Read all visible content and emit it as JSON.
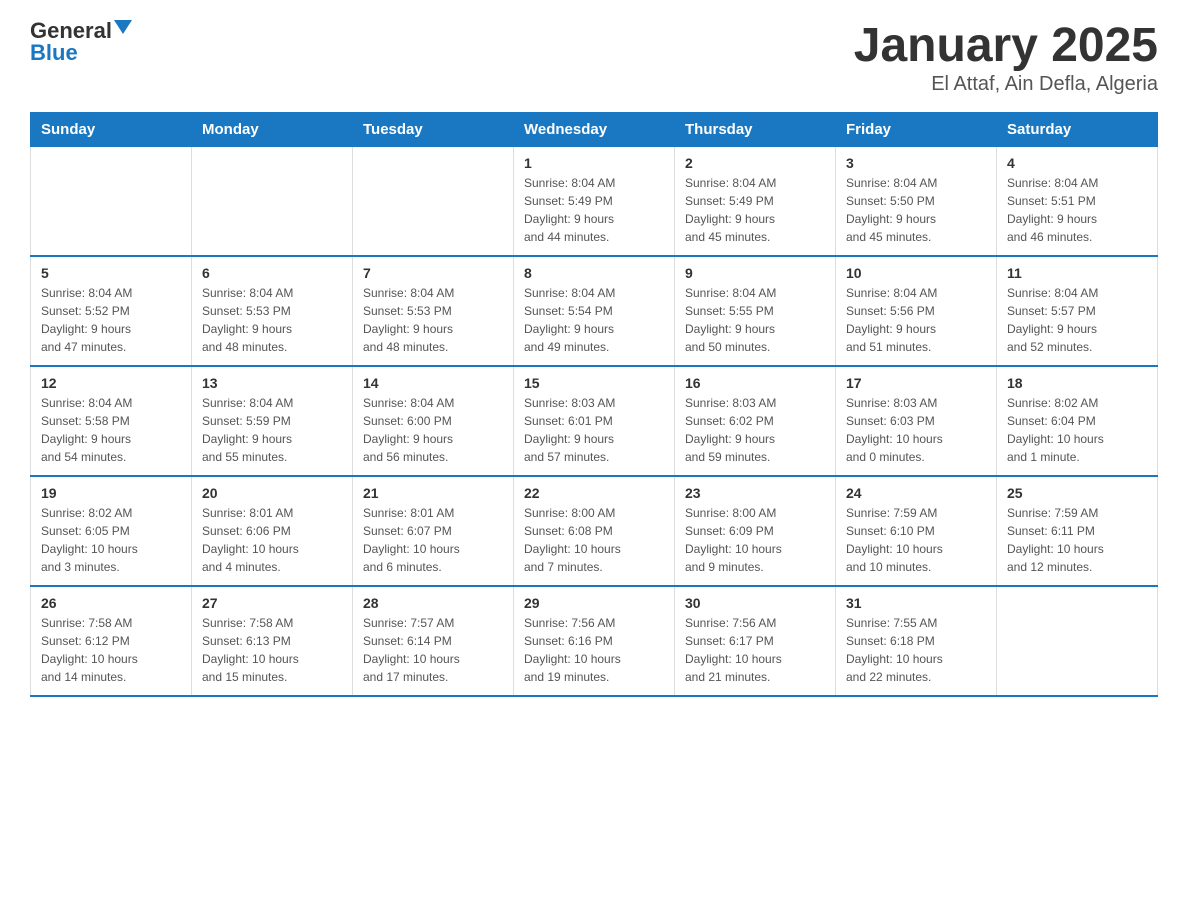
{
  "logo": {
    "text_general": "General",
    "text_blue": "Blue"
  },
  "title": "January 2025",
  "subtitle": "El Attaf, Ain Defla, Algeria",
  "days_of_week": [
    "Sunday",
    "Monday",
    "Tuesday",
    "Wednesday",
    "Thursday",
    "Friday",
    "Saturday"
  ],
  "weeks": [
    [
      {
        "day": "",
        "info": ""
      },
      {
        "day": "",
        "info": ""
      },
      {
        "day": "",
        "info": ""
      },
      {
        "day": "1",
        "info": "Sunrise: 8:04 AM\nSunset: 5:49 PM\nDaylight: 9 hours\nand 44 minutes."
      },
      {
        "day": "2",
        "info": "Sunrise: 8:04 AM\nSunset: 5:49 PM\nDaylight: 9 hours\nand 45 minutes."
      },
      {
        "day": "3",
        "info": "Sunrise: 8:04 AM\nSunset: 5:50 PM\nDaylight: 9 hours\nand 45 minutes."
      },
      {
        "day": "4",
        "info": "Sunrise: 8:04 AM\nSunset: 5:51 PM\nDaylight: 9 hours\nand 46 minutes."
      }
    ],
    [
      {
        "day": "5",
        "info": "Sunrise: 8:04 AM\nSunset: 5:52 PM\nDaylight: 9 hours\nand 47 minutes."
      },
      {
        "day": "6",
        "info": "Sunrise: 8:04 AM\nSunset: 5:53 PM\nDaylight: 9 hours\nand 48 minutes."
      },
      {
        "day": "7",
        "info": "Sunrise: 8:04 AM\nSunset: 5:53 PM\nDaylight: 9 hours\nand 48 minutes."
      },
      {
        "day": "8",
        "info": "Sunrise: 8:04 AM\nSunset: 5:54 PM\nDaylight: 9 hours\nand 49 minutes."
      },
      {
        "day": "9",
        "info": "Sunrise: 8:04 AM\nSunset: 5:55 PM\nDaylight: 9 hours\nand 50 minutes."
      },
      {
        "day": "10",
        "info": "Sunrise: 8:04 AM\nSunset: 5:56 PM\nDaylight: 9 hours\nand 51 minutes."
      },
      {
        "day": "11",
        "info": "Sunrise: 8:04 AM\nSunset: 5:57 PM\nDaylight: 9 hours\nand 52 minutes."
      }
    ],
    [
      {
        "day": "12",
        "info": "Sunrise: 8:04 AM\nSunset: 5:58 PM\nDaylight: 9 hours\nand 54 minutes."
      },
      {
        "day": "13",
        "info": "Sunrise: 8:04 AM\nSunset: 5:59 PM\nDaylight: 9 hours\nand 55 minutes."
      },
      {
        "day": "14",
        "info": "Sunrise: 8:04 AM\nSunset: 6:00 PM\nDaylight: 9 hours\nand 56 minutes."
      },
      {
        "day": "15",
        "info": "Sunrise: 8:03 AM\nSunset: 6:01 PM\nDaylight: 9 hours\nand 57 minutes."
      },
      {
        "day": "16",
        "info": "Sunrise: 8:03 AM\nSunset: 6:02 PM\nDaylight: 9 hours\nand 59 minutes."
      },
      {
        "day": "17",
        "info": "Sunrise: 8:03 AM\nSunset: 6:03 PM\nDaylight: 10 hours\nand 0 minutes."
      },
      {
        "day": "18",
        "info": "Sunrise: 8:02 AM\nSunset: 6:04 PM\nDaylight: 10 hours\nand 1 minute."
      }
    ],
    [
      {
        "day": "19",
        "info": "Sunrise: 8:02 AM\nSunset: 6:05 PM\nDaylight: 10 hours\nand 3 minutes."
      },
      {
        "day": "20",
        "info": "Sunrise: 8:01 AM\nSunset: 6:06 PM\nDaylight: 10 hours\nand 4 minutes."
      },
      {
        "day": "21",
        "info": "Sunrise: 8:01 AM\nSunset: 6:07 PM\nDaylight: 10 hours\nand 6 minutes."
      },
      {
        "day": "22",
        "info": "Sunrise: 8:00 AM\nSunset: 6:08 PM\nDaylight: 10 hours\nand 7 minutes."
      },
      {
        "day": "23",
        "info": "Sunrise: 8:00 AM\nSunset: 6:09 PM\nDaylight: 10 hours\nand 9 minutes."
      },
      {
        "day": "24",
        "info": "Sunrise: 7:59 AM\nSunset: 6:10 PM\nDaylight: 10 hours\nand 10 minutes."
      },
      {
        "day": "25",
        "info": "Sunrise: 7:59 AM\nSunset: 6:11 PM\nDaylight: 10 hours\nand 12 minutes."
      }
    ],
    [
      {
        "day": "26",
        "info": "Sunrise: 7:58 AM\nSunset: 6:12 PM\nDaylight: 10 hours\nand 14 minutes."
      },
      {
        "day": "27",
        "info": "Sunrise: 7:58 AM\nSunset: 6:13 PM\nDaylight: 10 hours\nand 15 minutes."
      },
      {
        "day": "28",
        "info": "Sunrise: 7:57 AM\nSunset: 6:14 PM\nDaylight: 10 hours\nand 17 minutes."
      },
      {
        "day": "29",
        "info": "Sunrise: 7:56 AM\nSunset: 6:16 PM\nDaylight: 10 hours\nand 19 minutes."
      },
      {
        "day": "30",
        "info": "Sunrise: 7:56 AM\nSunset: 6:17 PM\nDaylight: 10 hours\nand 21 minutes."
      },
      {
        "day": "31",
        "info": "Sunrise: 7:55 AM\nSunset: 6:18 PM\nDaylight: 10 hours\nand 22 minutes."
      },
      {
        "day": "",
        "info": ""
      }
    ]
  ]
}
